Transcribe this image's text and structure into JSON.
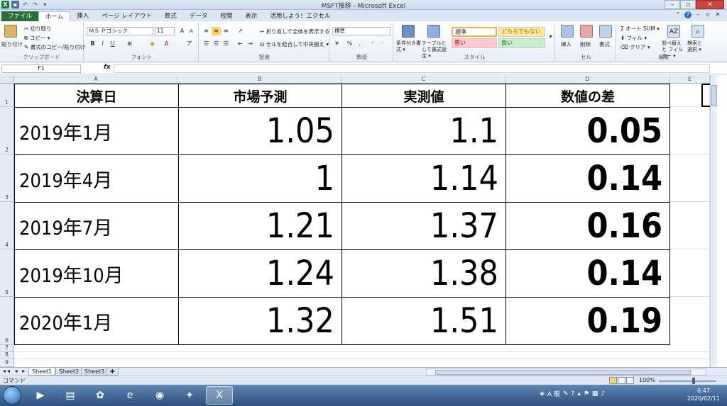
{
  "window": {
    "title": "MSFT推移 - Microsoft Excel"
  },
  "tabs": [
    {
      "label": "ファイル"
    },
    {
      "label": "ホーム"
    },
    {
      "label": "挿入"
    },
    {
      "label": "ページ レイアウト"
    },
    {
      "label": "数式"
    },
    {
      "label": "データ"
    },
    {
      "label": "校閲"
    },
    {
      "label": "表示"
    },
    {
      "label": "活用しよう！エクセル"
    }
  ],
  "ribbon": {
    "clipboard": {
      "paste": "貼り付け",
      "cut": "切り取り",
      "copy": "コピー ▾",
      "format_painter": "書式のコピー/貼り付け",
      "label": "クリップボード"
    },
    "font": {
      "name": "ＭＳ Ｐゴシック",
      "size": "11",
      "bold": "B",
      "italic": "I",
      "underline": "U",
      "label": "フォント"
    },
    "alignment": {
      "wrap": "折り返して全体を表示する",
      "merge": "セルを結合して中央揃え ▾",
      "label": "配置"
    },
    "number": {
      "format": "標準",
      "percent": "%",
      "comma": ",",
      "label": "数値"
    },
    "styles": {
      "conditional": "条件付き書式 ▾",
      "table": "テーブルとして書式設定 ▾",
      "cell_standard": "標準",
      "cell_neutral": "どちらでもない",
      "cell_bad": "悪い",
      "cell_good": "良い",
      "label": "スタイル"
    },
    "cells": {
      "insert": "挿入",
      "delete": "削除",
      "format": "書式",
      "label": "セル"
    },
    "editing": {
      "autosum": "Σ オート SUM ▾",
      "fill": "フィル ▾",
      "clear": "クリア ▾",
      "sort": "並べ替えと フィルター ▾",
      "find": "検索と 選択 ▾",
      "label": "編集"
    }
  },
  "formula_bar": {
    "name_box": "F1",
    "fx": "fx",
    "value": ""
  },
  "columns": [
    "A",
    "B",
    "C",
    "D",
    "E"
  ],
  "rows": [
    "1",
    "2",
    "3",
    "4",
    "5",
    "6",
    "7",
    "8",
    "9"
  ],
  "table": {
    "headers": [
      "決算日",
      "市場予測",
      "実測値",
      "数値の差"
    ],
    "rows": [
      [
        "2019年1月",
        "1.05",
        "1.1",
        "0.05"
      ],
      [
        "2019年4月",
        "1",
        "1.14",
        "0.14"
      ],
      [
        "2019年7月",
        "1.21",
        "1.37",
        "0.16"
      ],
      [
        "2019年10月",
        "1.24",
        "1.38",
        "0.14"
      ],
      [
        "2020年1月",
        "1.32",
        "1.51",
        "0.19"
      ]
    ]
  },
  "sheets": [
    "Sheet1",
    "Sheet2",
    "Sheet3"
  ],
  "status": {
    "mode": "コマンド",
    "zoom": "100%"
  },
  "taskbar": {
    "time": "6:47",
    "date": "2020/02/11",
    "ime": "A 般"
  }
}
